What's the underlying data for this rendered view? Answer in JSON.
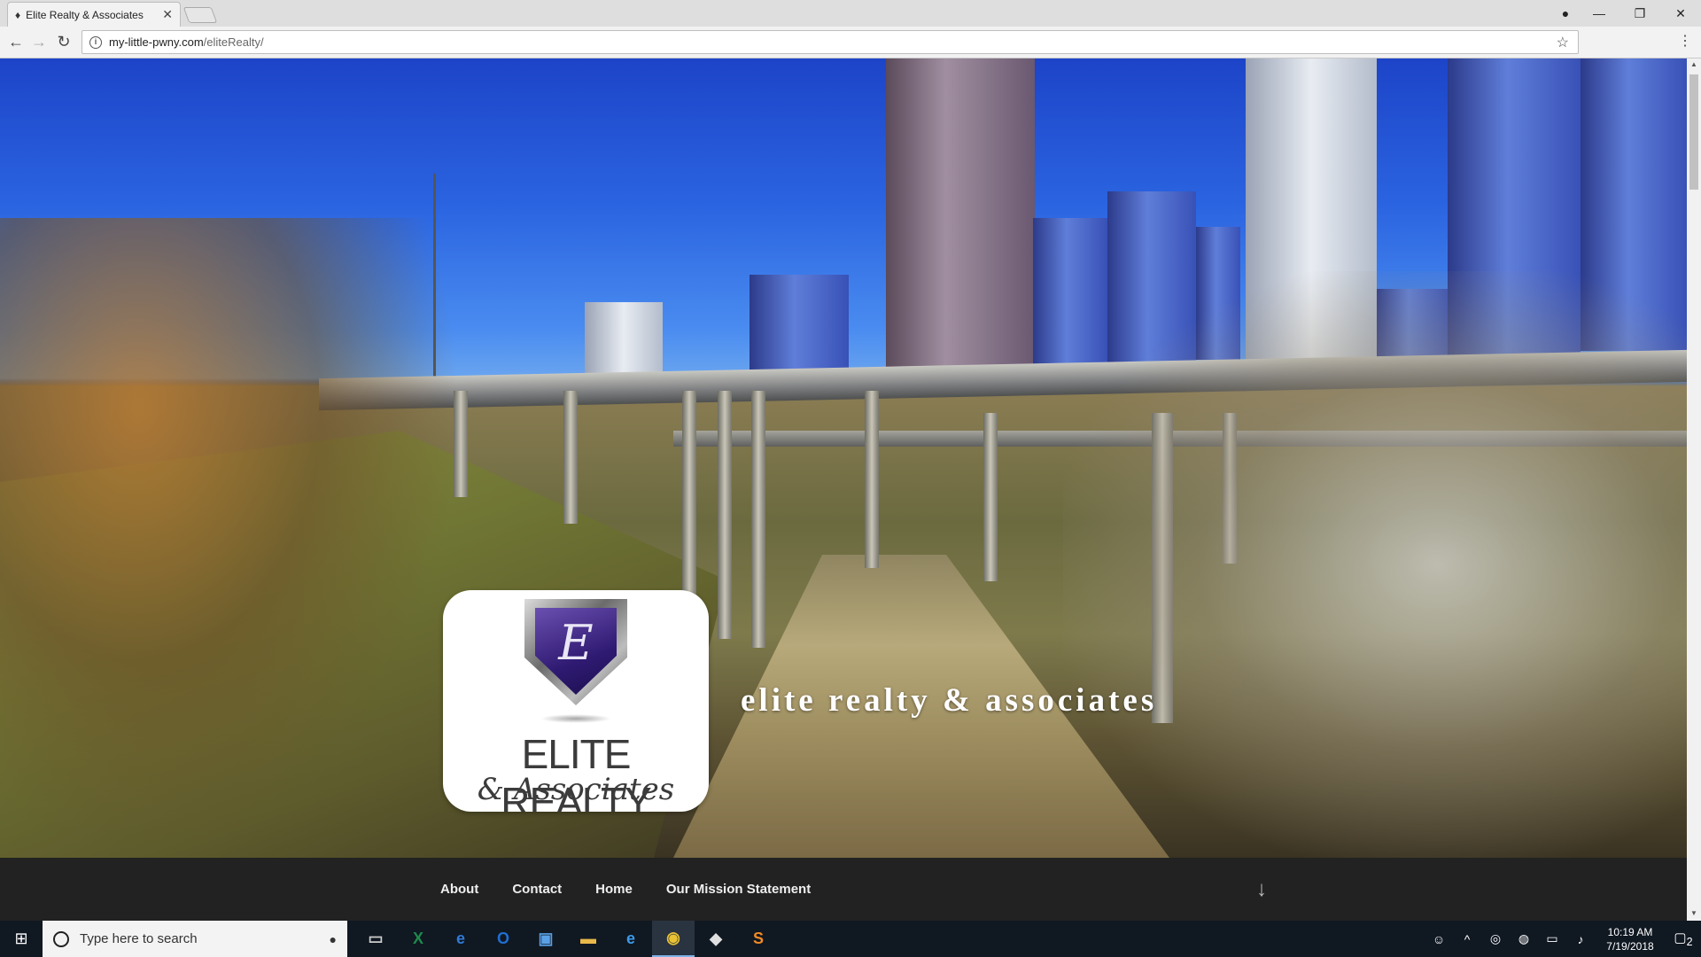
{
  "browser": {
    "tab_title": "Elite Realty & Associates",
    "tab_close": "✕",
    "url_host": "my-little-pwny.com",
    "url_path": "/eliteRealty/"
  },
  "page": {
    "hero_title": "elite realty & associates",
    "logo": {
      "letter": "E",
      "name": "ELITE REALTY",
      "sub": "& Associates"
    },
    "nav": [
      "About",
      "Contact",
      "Home",
      "Our Mission Statement"
    ],
    "scroll_arrow": "↓"
  },
  "taskbar": {
    "search_placeholder": "Type here to search",
    "time": "10:19 AM",
    "date": "7/19/2018",
    "notification_count": "2"
  },
  "icons": {
    "back": "back-arrow-icon",
    "forward": "forward-arrow-icon",
    "reload": "reload-icon",
    "info": "info-icon",
    "star": "bookmark-star-icon",
    "menu": "kebab-menu-icon"
  },
  "colors": {
    "navbar_bg": "#222222",
    "taskbar_bg": "#101822",
    "sky": "#2a63e0",
    "shield": "#2f1a72"
  }
}
